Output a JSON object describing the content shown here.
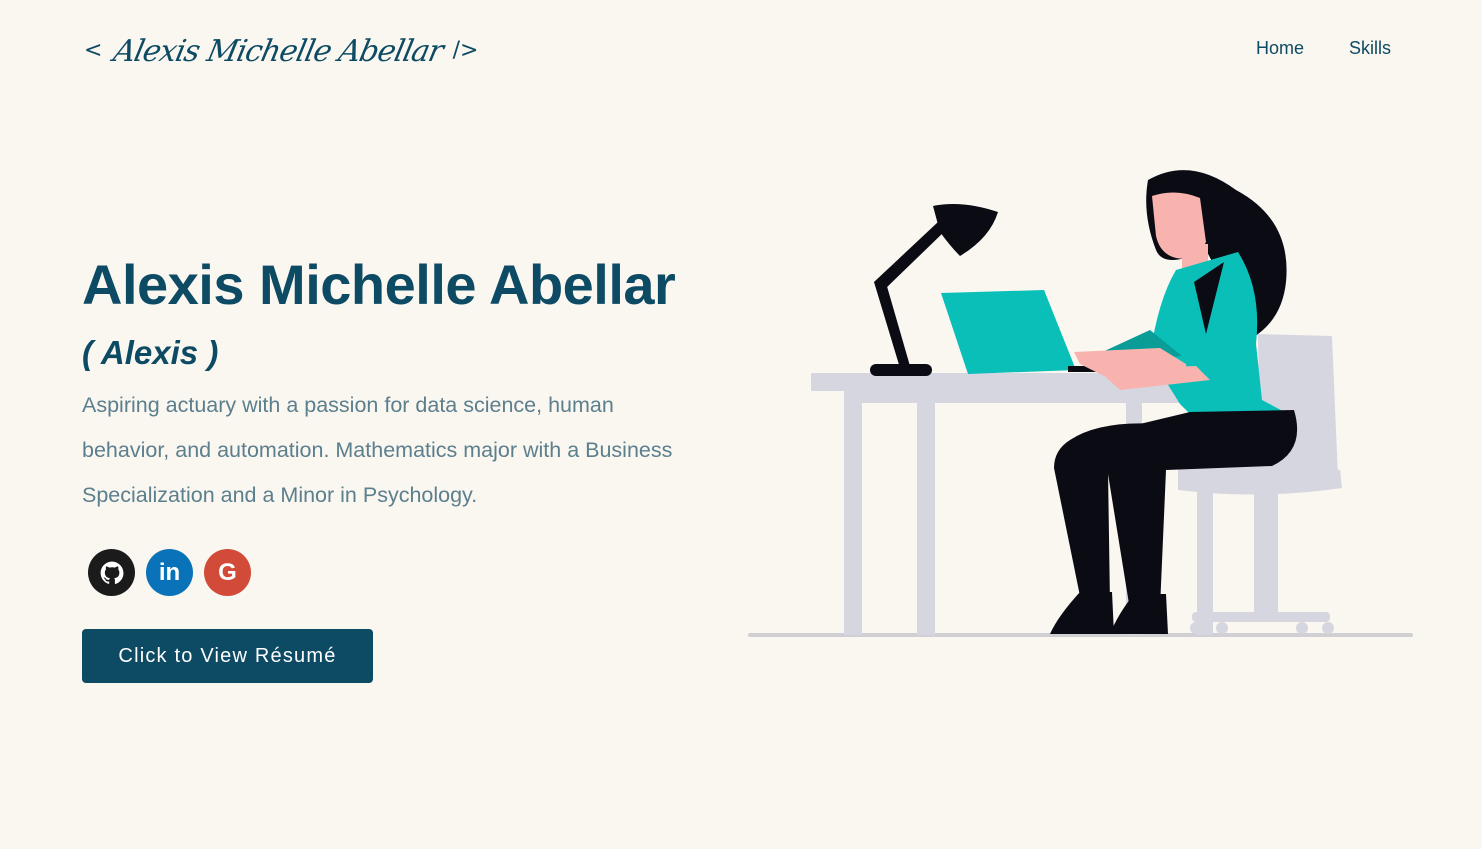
{
  "header": {
    "logo": {
      "open_bracket": "<",
      "signature": "Alexis Michelle Abellar",
      "close_bracket": "/>"
    },
    "nav": [
      {
        "label": "Home"
      },
      {
        "label": "Skills"
      }
    ]
  },
  "hero": {
    "name": "Alexis Michelle Abellar",
    "nickname": "( Alexis )",
    "bio": "Aspiring actuary with a passion for data science, human behavior, and automation. Mathematics major with a Business Specialization and a Minor in Psychology.",
    "socials": [
      {
        "icon": "github-icon",
        "color": "#1b1b1b"
      },
      {
        "icon": "linkedin-icon",
        "glyph": "in",
        "color": "#0a72b8"
      },
      {
        "icon": "google-icon",
        "glyph": "G",
        "color": "#d24b38"
      }
    ],
    "resume_button": "Click to View Résumé"
  },
  "illustration": {
    "subject": "woman-at-desk-with-laptop",
    "colors": {
      "accent": "#0bbfb9",
      "furniture": "#d6d6e0",
      "dark": "#0b0b14",
      "skin": "#f8b3ae"
    }
  },
  "theme": {
    "background": "#faf6f0",
    "primary": "#0d4a63",
    "text_muted": "#5c7f8e"
  }
}
